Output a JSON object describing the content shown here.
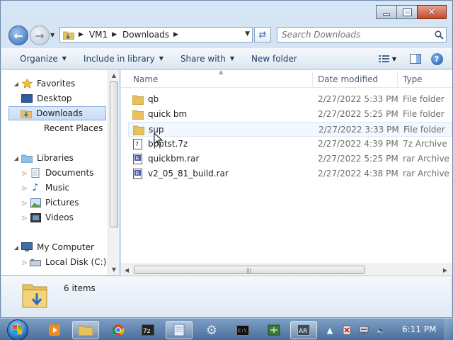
{
  "window": {
    "buttons": {
      "minimize": "minimize-icon",
      "maximize": "maximize-icon",
      "close": "close-icon"
    }
  },
  "address": {
    "crumbs": [
      "VM1",
      "Downloads"
    ]
  },
  "search": {
    "placeholder": "Search Downloads"
  },
  "toolbar": {
    "organize": "Organize",
    "include_in_library": "Include in library",
    "share_with": "Share with",
    "new_folder": "New folder"
  },
  "navpane": {
    "favorites": "Favorites",
    "desktop": "Desktop",
    "downloads": "Downloads",
    "recent_places": "Recent Places",
    "libraries": "Libraries",
    "documents": "Documents",
    "music": "Music",
    "pictures": "Pictures",
    "videos": "Videos",
    "my_computer": "My Computer",
    "local_disk": "Local Disk (C:)"
  },
  "columns": {
    "name": "Name",
    "date_modified": "Date modified",
    "type": "Type"
  },
  "files": [
    {
      "name": "qb",
      "date": "2/27/2022 5:33 PM",
      "type": "File folder",
      "icon": "folder-icon"
    },
    {
      "name": "quick bm",
      "date": "2/27/2022 5:25 PM",
      "type": "File folder",
      "icon": "folder-icon"
    },
    {
      "name": "sup",
      "date": "2/27/2022 3:33 PM",
      "type": "File folder",
      "icon": "folder-icon"
    },
    {
      "name": "bpptst.7z",
      "date": "2/27/2022 4:39 PM",
      "type": "7z Archive",
      "icon": "archive-7z-icon"
    },
    {
      "name": "quickbm.rar",
      "date": "2/27/2022 5:25 PM",
      "type": "rar Archive",
      "icon": "archive-rar-icon"
    },
    {
      "name": "v2_05_81_build.rar",
      "date": "2/27/2022 4:38 PM",
      "type": "rar Archive",
      "icon": "archive-rar-icon"
    }
  ],
  "details": {
    "count": "6 items"
  },
  "taskbar": {
    "clock": "6:11 PM",
    "pinned": [
      "media-player-icon",
      "explorer-icon",
      "chrome-icon",
      "7zip-icon",
      "notepad-icon",
      "gear-app-icon",
      "cmd-icon",
      "network-app-icon",
      "ar-app-icon"
    ]
  },
  "colors": {
    "accent": "#3e6bb0",
    "selection": "#c6dcf6",
    "folder": "#e8c15a"
  }
}
